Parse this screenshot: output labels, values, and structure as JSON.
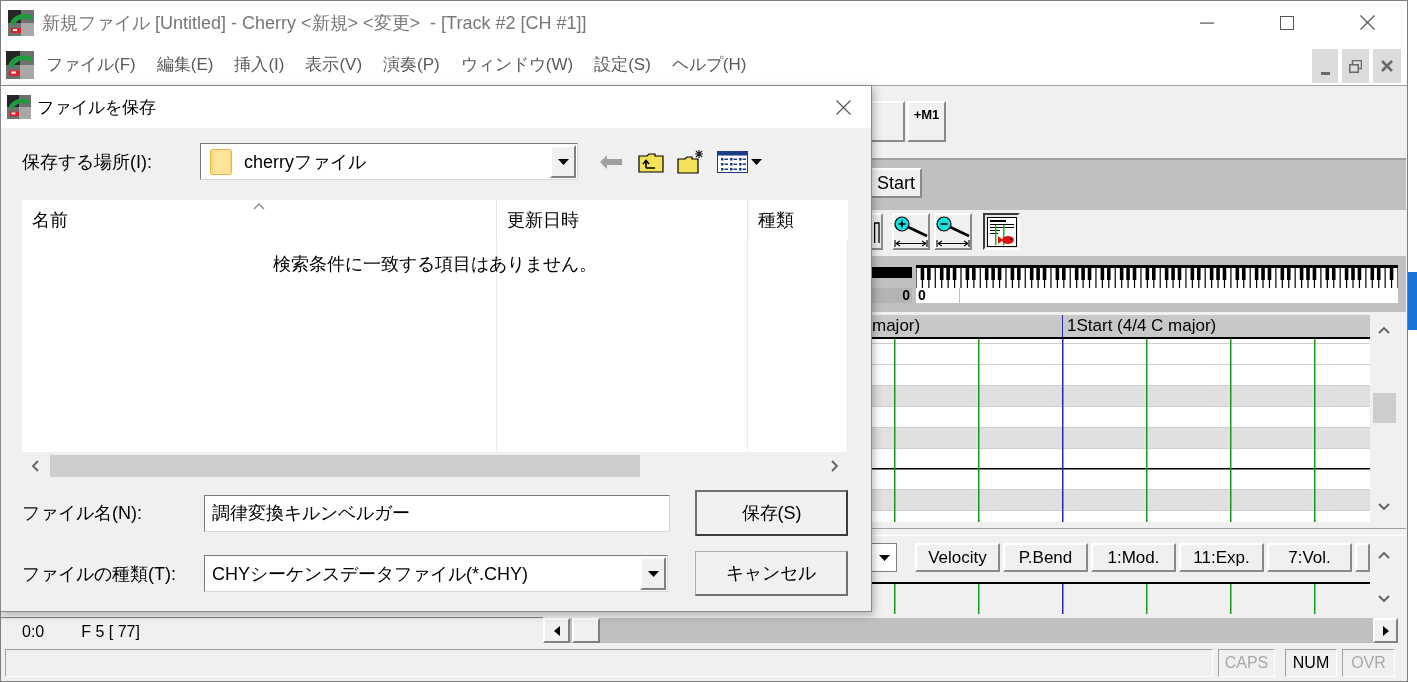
{
  "window": {
    "title": "新規ファイル [Untitled] - Cherry <新規> <変更>  - [Track #2 [CH #1]]"
  },
  "menu": [
    "ファイル(F)",
    "編集(E)",
    "挿入(I)",
    "表示(V)",
    "演奏(P)",
    "ウィンドウ(W)",
    "設定(S)",
    "ヘルプ(H)"
  ],
  "toolbar": [
    {
      "kind": "blank"
    },
    {
      "kind": "text",
      "label": "+M1"
    }
  ],
  "marker_bar": {
    "button": "Start"
  },
  "tools": [
    {
      "kind": "step",
      "pressed": false
    },
    {
      "kind": "zoom-in",
      "pressed": false
    },
    {
      "kind": "zoom-out",
      "pressed": false
    },
    {
      "kind": "score",
      "pressed": true
    }
  ],
  "keyboard": {
    "values": [
      "0",
      "0"
    ]
  },
  "piano_roll": {
    "header": [
      "major)",
      "1Start (4/4 C major)"
    ]
  },
  "controller": {
    "tabs": [
      {
        "label": "Velocity",
        "selected": false
      },
      {
        "label": "P.Bend",
        "selected": false
      },
      {
        "label": "1:Mod.",
        "selected": false
      },
      {
        "label": "11:Exp.",
        "selected": false
      },
      {
        "label": "7:Vol.",
        "selected": false
      }
    ]
  },
  "position": {
    "time": "0:0",
    "note": "F 5 [ 77]"
  },
  "status_bar": {
    "indicators": [
      {
        "label": "CAPS",
        "on": false
      },
      {
        "label": "NUM",
        "on": true
      },
      {
        "label": "OVR",
        "on": false
      }
    ]
  },
  "dialog": {
    "title": "ファイルを保存",
    "location_label": "保存する場所(I):",
    "location": "cherryファイル",
    "columns": [
      {
        "label": "名前",
        "sorted": true
      },
      {
        "label": "更新日時",
        "sorted": false
      },
      {
        "label": "種類",
        "sorted": false
      }
    ],
    "empty_message": "検索条件に一致する項目はありません。",
    "filename_label": "ファイル名(N):",
    "filename": "調律変換キルンベルガー",
    "filetype_label": "ファイルの種類(T):",
    "filetype": "CHYシーケンスデータファイル(*.CHY)",
    "buttons": [
      {
        "label": "保存(S)",
        "default": true
      },
      {
        "label": "キャンセル",
        "default": false
      }
    ]
  }
}
